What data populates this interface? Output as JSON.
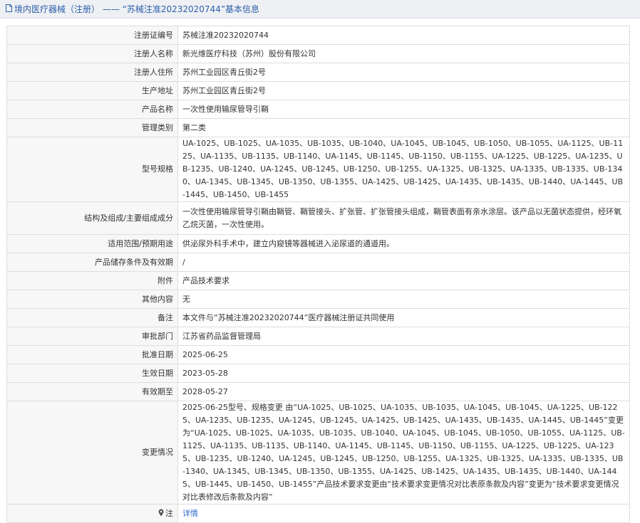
{
  "header": {
    "title": "境内医疗器械（注册） —— “苏械注准20232020744”基本信息",
    "icon": "document-icon"
  },
  "rows": [
    {
      "label": "注册证编号",
      "value": "苏械注准20232020744"
    },
    {
      "label": "注册人名称",
      "value": "新光维医疗科技（苏州）股份有限公司"
    },
    {
      "label": "注册人住所",
      "value": "苏州工业园区青丘街2号"
    },
    {
      "label": "生产地址",
      "value": "苏州工业园区青丘街2号"
    },
    {
      "label": "产品名称",
      "value": "一次性使用输尿管导引鞘"
    },
    {
      "label": "管理类别",
      "value": "第二类"
    },
    {
      "label": "型号规格",
      "value": "UA-1025、UB-1025、UA-1035、UB-1035、UB-1040、UA-1045、UB-1045、UB-1050、UB-1055、UA-1125、UB-1125、UA-1135、UB-1135、UB-1140、UA-1145、UB-1145、UB-1150、UB-1155、UA-1225、UB-1225、UA-1235、UB-1235、UB-1240、UA-1245、UB-1245、UB-1250、UB-1255、UA-1325、UB-1325、UA-1335、UB-1335、UB-1340、UA-1345、UB-1345、UB-1350、UB-1355、UA-1425、UB-1425、UA-1435、UB-1435、UB-1440、UA-1445、UB-1445、UB-1450、UB-1455"
    },
    {
      "label": "结构及组成/主要组成成分",
      "value": "一次性使用输尿管导引鞘由鞘管、鞘管接头、扩张管、扩张管接头组成，鞘管表面有亲水涂层。该产品以无菌状态提供，经环氧乙烷灭菌，一次性使用。"
    },
    {
      "label": "适用范围/预期用途",
      "value": "供泌尿外科手术中，建立内窥镜等器械进入泌尿道的通道用。"
    },
    {
      "label": "产品储存条件及有效期",
      "value": "/"
    },
    {
      "label": "附件",
      "value": "产品技术要求"
    },
    {
      "label": "其他内容",
      "value": "无"
    },
    {
      "label": "备注",
      "value": "本文件与“苏械注准20232020744”医疗器械注册证共同使用"
    },
    {
      "label": "审批部门",
      "value": "江苏省药品监督管理局"
    },
    {
      "label": "批准日期",
      "value": "2025-06-25"
    },
    {
      "label": "生效日期",
      "value": "2023-05-28"
    },
    {
      "label": "有效期至",
      "value": "2028-05-27"
    },
    {
      "label": "变更情况",
      "value": "2025-06-25型号、规格变更 由“UA-1025、UB-1025、UA-1035、UB-1035、UA-1045、UB-1045、UA-1225、UB-1225、UA-1235、UB-1235、UA-1245、UB-1245、UA-1425、UB-1425、UA-1435、UB-1435、UA-1445、UB-1445”变更为“UA-1025、UB-1025、UA-1035、UB-1035、UB-1040、UA-1045、UB-1045、UB-1050、UB-1055、UA-1125、UB-1125、UA-1135、UB-1135、UB-1140、UA-1145、UB-1145、UB-1150、UB-1155、UA-1225、UB-1225、UA-1235、UB-1235、UB-1240、UA-1245、UB-1245、UB-1250、UB-1255、UA-1325、UB-1325、UA-1335、UB-1335、UB-1340、UA-1345、UB-1345、UB-1350、UB-1355、UA-1425、UB-1425、UA-1435、UB-1435、UB-1440、UA-1445、UB-1445、UB-1450、UB-1455”产品技术要求变更由“技术要求变更情况对比表原条款及内容”变更为“技术要求变更情况对比表修改后条款及内容”"
    }
  ],
  "note": {
    "label": "注",
    "icon": "pin-icon",
    "link_text": "详情"
  },
  "colors": {
    "link": "#2d6bc8",
    "header_text": "#2d5fa8",
    "label_bg": "#f7f7f7",
    "border": "#dddddd"
  }
}
